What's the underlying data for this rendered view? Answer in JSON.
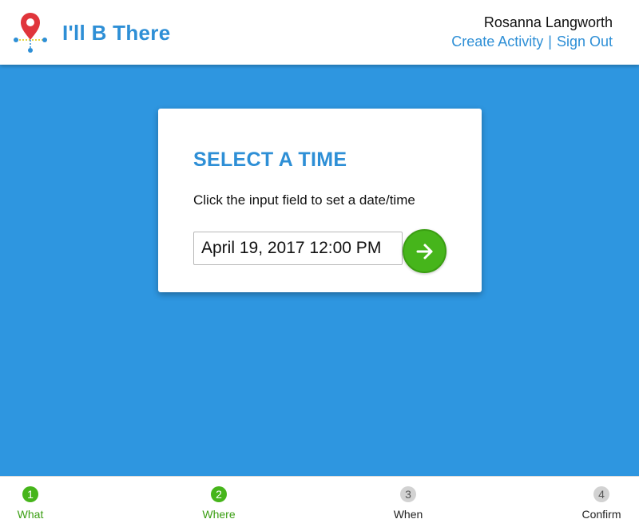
{
  "header": {
    "brand": "I'll B There",
    "logo_icon": "map-pin-icon",
    "user_name": "Rosanna Langworth",
    "links": {
      "create_activity": "Create Activity",
      "separator": "|",
      "sign_out": "Sign Out"
    }
  },
  "card": {
    "title": "SELECT A TIME",
    "instructions": "Click the input field to set a date/time",
    "datetime_value": "April 19, 2017 12:00 PM",
    "next_icon": "arrow-right-icon"
  },
  "steps": [
    {
      "number": "1",
      "label": "What",
      "status": "done"
    },
    {
      "number": "2",
      "label": "Where",
      "status": "done"
    },
    {
      "number": "3",
      "label": "When",
      "status": "pending"
    },
    {
      "number": "4",
      "label": "Confirm",
      "status": "pending"
    }
  ],
  "colors": {
    "brand_blue": "#2e8fd6",
    "background_blue": "#2e96e0",
    "success_green": "#46b51b",
    "pending_gray": "#d2d2d2",
    "pin_red": "#e0353b"
  }
}
